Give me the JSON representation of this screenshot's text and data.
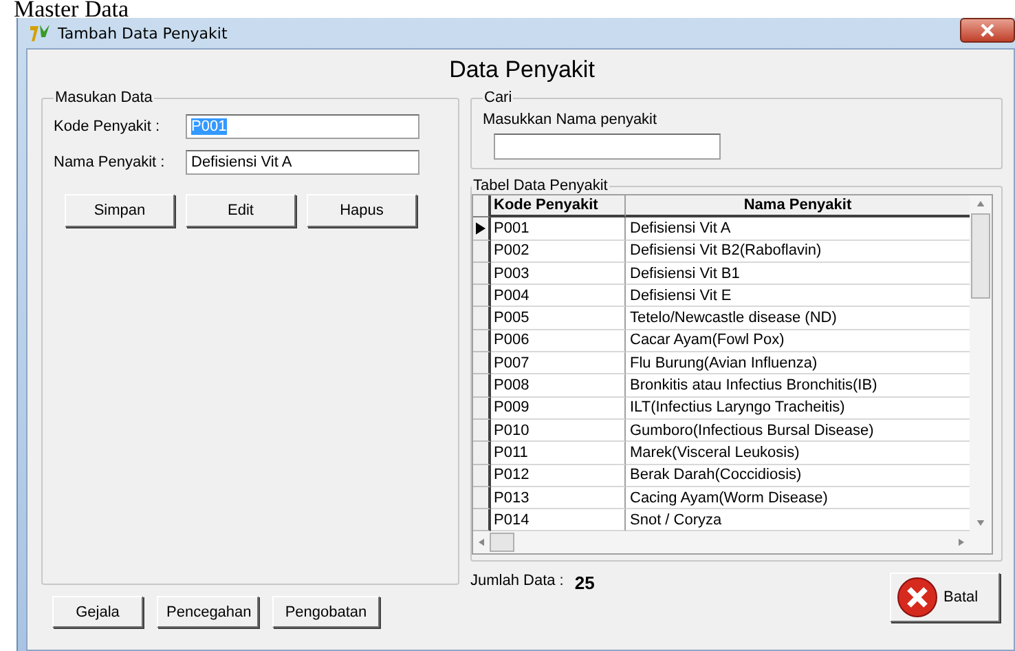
{
  "page_heading": "Master Data",
  "window": {
    "title": "Tambah Data Penyakit"
  },
  "form_title": "Data Penyakit",
  "input_group": {
    "legend": "Masukan Data",
    "fields": [
      {
        "label": "Kode Penyakit :",
        "value": "P001",
        "highlighted": true
      },
      {
        "label": "Nama Penyakit :",
        "value": "Defisiensi Vit A",
        "highlighted": false
      }
    ],
    "buttons": [
      "Simpan",
      "Edit",
      "Hapus"
    ]
  },
  "search_group": {
    "legend": "Cari",
    "label": "Masukkan Nama penyakit"
  },
  "table_group": {
    "legend": "Tabel Data Penyakit",
    "columns": [
      "Kode Penyakit",
      "Nama Penyakit"
    ],
    "rows": [
      {
        "code": "P001",
        "name": "Defisiensi Vit A",
        "selected": true
      },
      {
        "code": "P002",
        "name": "Defisiensi Vit B2(Raboflavin)",
        "selected": false
      },
      {
        "code": "P003",
        "name": "Defisiensi Vit B1",
        "selected": false
      },
      {
        "code": "P004",
        "name": "Defisiensi Vit E",
        "selected": false
      },
      {
        "code": "P005",
        "name": "Tetelo/Newcastle disease (ND)",
        "selected": false
      },
      {
        "code": "P006",
        "name": "Cacar Ayam(Fowl Pox)",
        "selected": false
      },
      {
        "code": "P007",
        "name": "Flu Burung(Avian Influenza)",
        "selected": false
      },
      {
        "code": "P008",
        "name": "Bronkitis atau Infectius Bronchitis(IB)",
        "selected": false
      },
      {
        "code": "P009",
        "name": "ILT(Infectius Laryngo Tracheitis)",
        "selected": false
      },
      {
        "code": "P010",
        "name": "Gumboro(Infectious Bursal Disease)",
        "selected": false
      },
      {
        "code": "P011",
        "name": "Marek(Visceral Leukosis)",
        "selected": false
      },
      {
        "code": "P012",
        "name": "Berak Darah(Coccidiosis)",
        "selected": false
      },
      {
        "code": "P013",
        "name": "Cacing Ayam(Worm Disease)",
        "selected": false
      },
      {
        "code": "P014",
        "name": "Snot / Coryza",
        "selected": false
      }
    ]
  },
  "bottom_buttons": [
    "Gejala",
    "Pencegahan",
    "Pengobatan"
  ],
  "count": {
    "label": "Jumlah Data :",
    "value": "25"
  },
  "cancel_button": "Batal"
}
